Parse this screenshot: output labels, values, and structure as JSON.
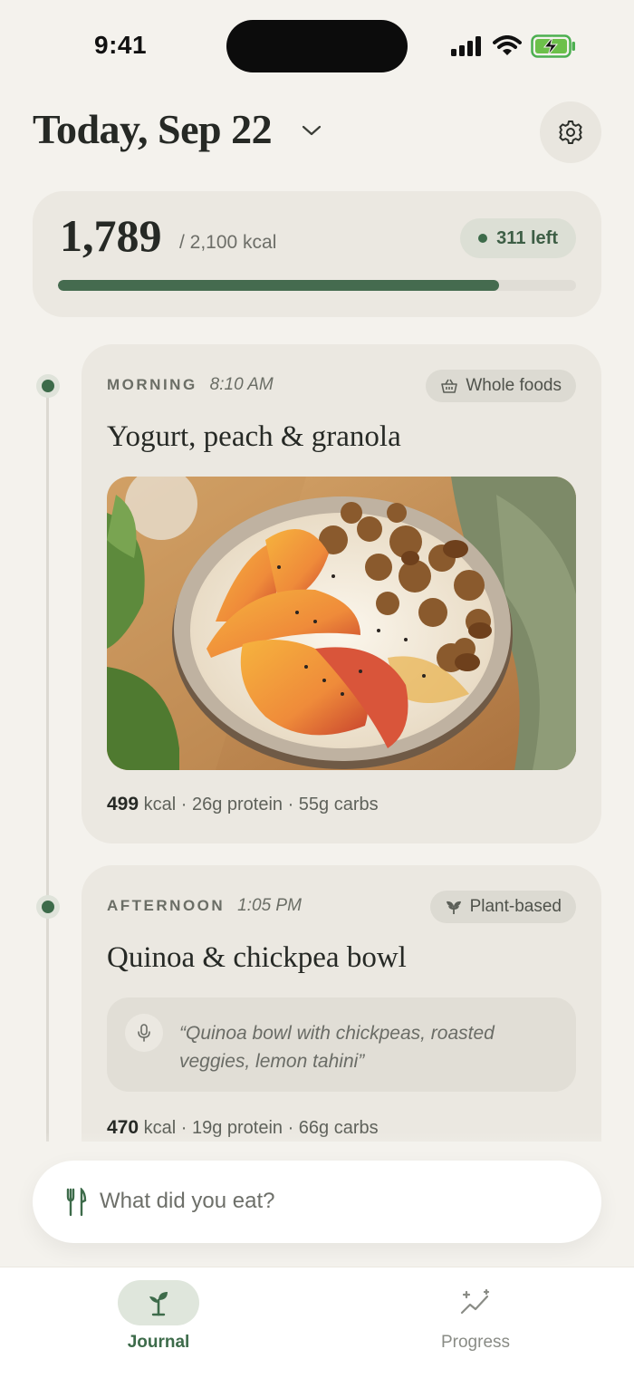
{
  "status_bar": {
    "time": "9:41"
  },
  "header": {
    "date_title": "Today, Sep 22"
  },
  "calories": {
    "consumed": "1,789",
    "goal_text": "/ 2,100 kcal",
    "left_label": "311 left",
    "progress_fraction": 0.852
  },
  "meals": [
    {
      "period": "MORNING",
      "time": "8:10 AM",
      "tag": "Whole foods",
      "tag_icon": "basket-icon",
      "title": "Yogurt, peach & granola",
      "kcal": "499",
      "macros_rest": "kcal · 26g protein · 55g carbs"
    },
    {
      "period": "AFTERNOON",
      "time": "1:05 PM",
      "tag": "Plant-based",
      "tag_icon": "sprout-icon",
      "title": "Quinoa & chickpea bowl",
      "voice_note": "“Quinoa bowl with chickpeas, roasted veggies, lemon tahini”",
      "kcal": "470",
      "macros_rest": "kcal · 19g protein · 66g carbs"
    }
  ],
  "input": {
    "placeholder": "What did you eat?"
  },
  "tabs": [
    {
      "label": "Journal",
      "icon": "sprout-icon",
      "active": true
    },
    {
      "label": "Progress",
      "icon": "sparkle-chart-icon",
      "active": false
    }
  ],
  "colors": {
    "accent": "#3d6b4a",
    "background": "#f4f2ed",
    "card": "#ebe8e1"
  }
}
